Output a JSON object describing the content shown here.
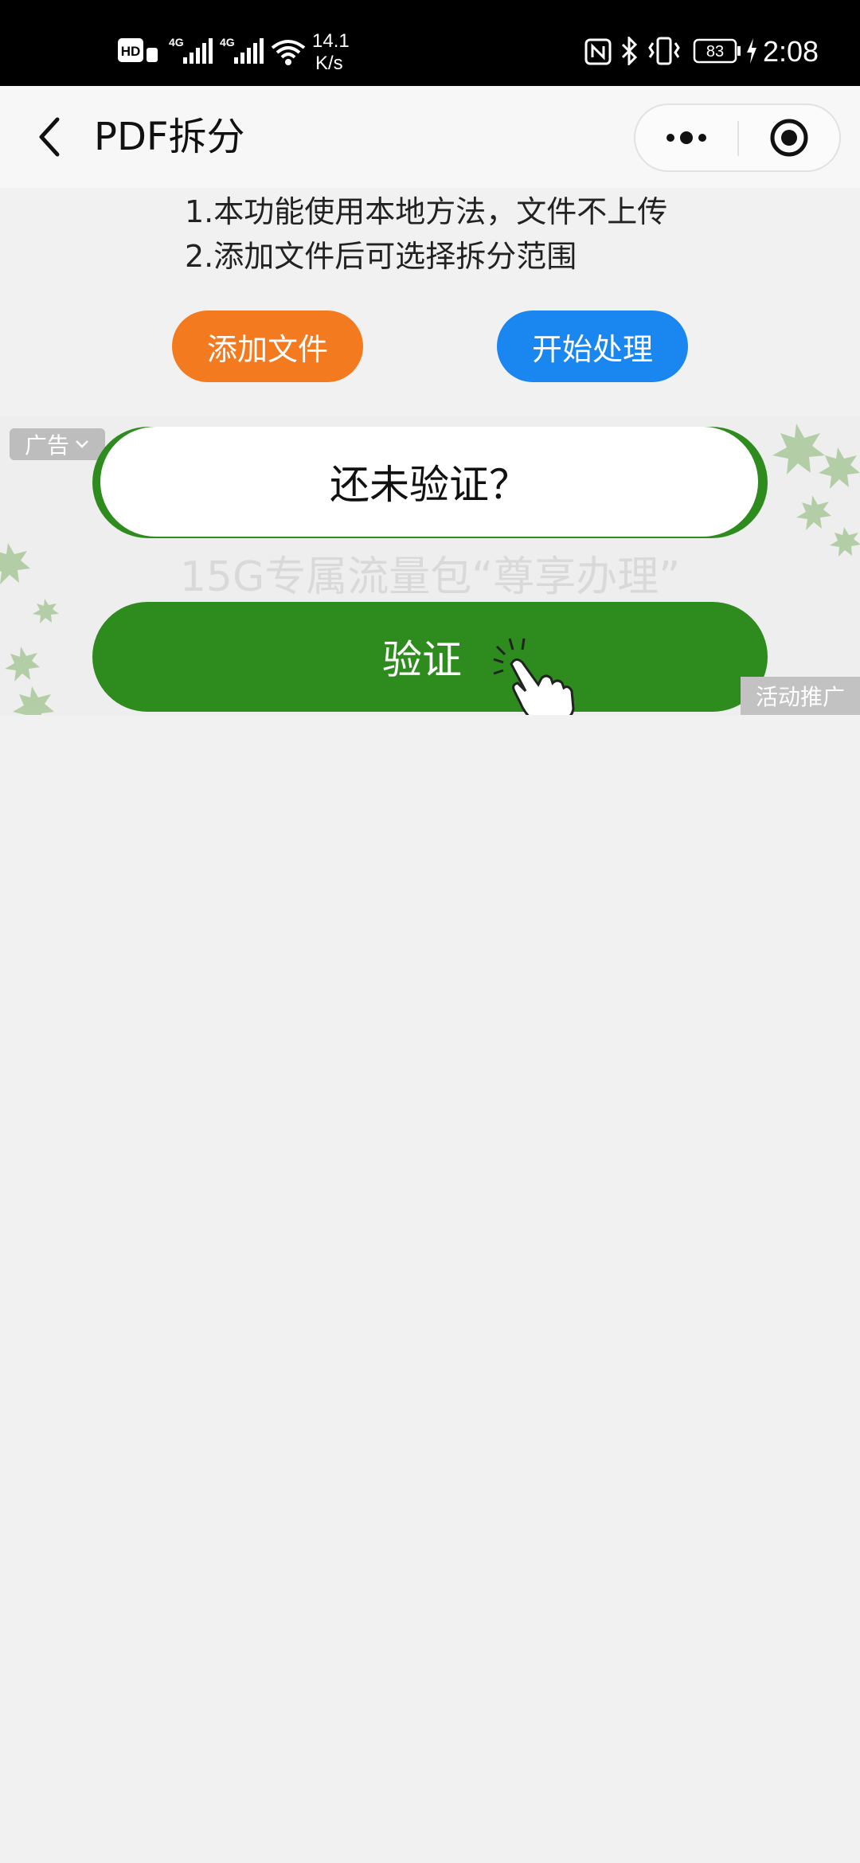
{
  "status_bar": {
    "hd_label": "HD",
    "sim1_label": "4G",
    "sim2_label": "4G",
    "speed_value": "14.1",
    "speed_unit": "K/s",
    "battery": "83",
    "time": "2:08"
  },
  "nav": {
    "title": "PDF拆分"
  },
  "notes": [
    "1.本功能使用本地方法，文件不上传",
    "2.添加文件后可选择拆分范围"
  ],
  "buttons": {
    "add_file": "添加文件",
    "start": "开始处理"
  },
  "ad": {
    "tag": "广告",
    "question": "还未验证？",
    "promo": "15G专属流量包“尊享办理”",
    "verify": "验证",
    "promo_tag": "活动推广"
  },
  "colors": {
    "orange": "#f47a1f",
    "blue": "#1a86f0",
    "green": "#2e8b1e",
    "background": "#f1f1f1"
  }
}
